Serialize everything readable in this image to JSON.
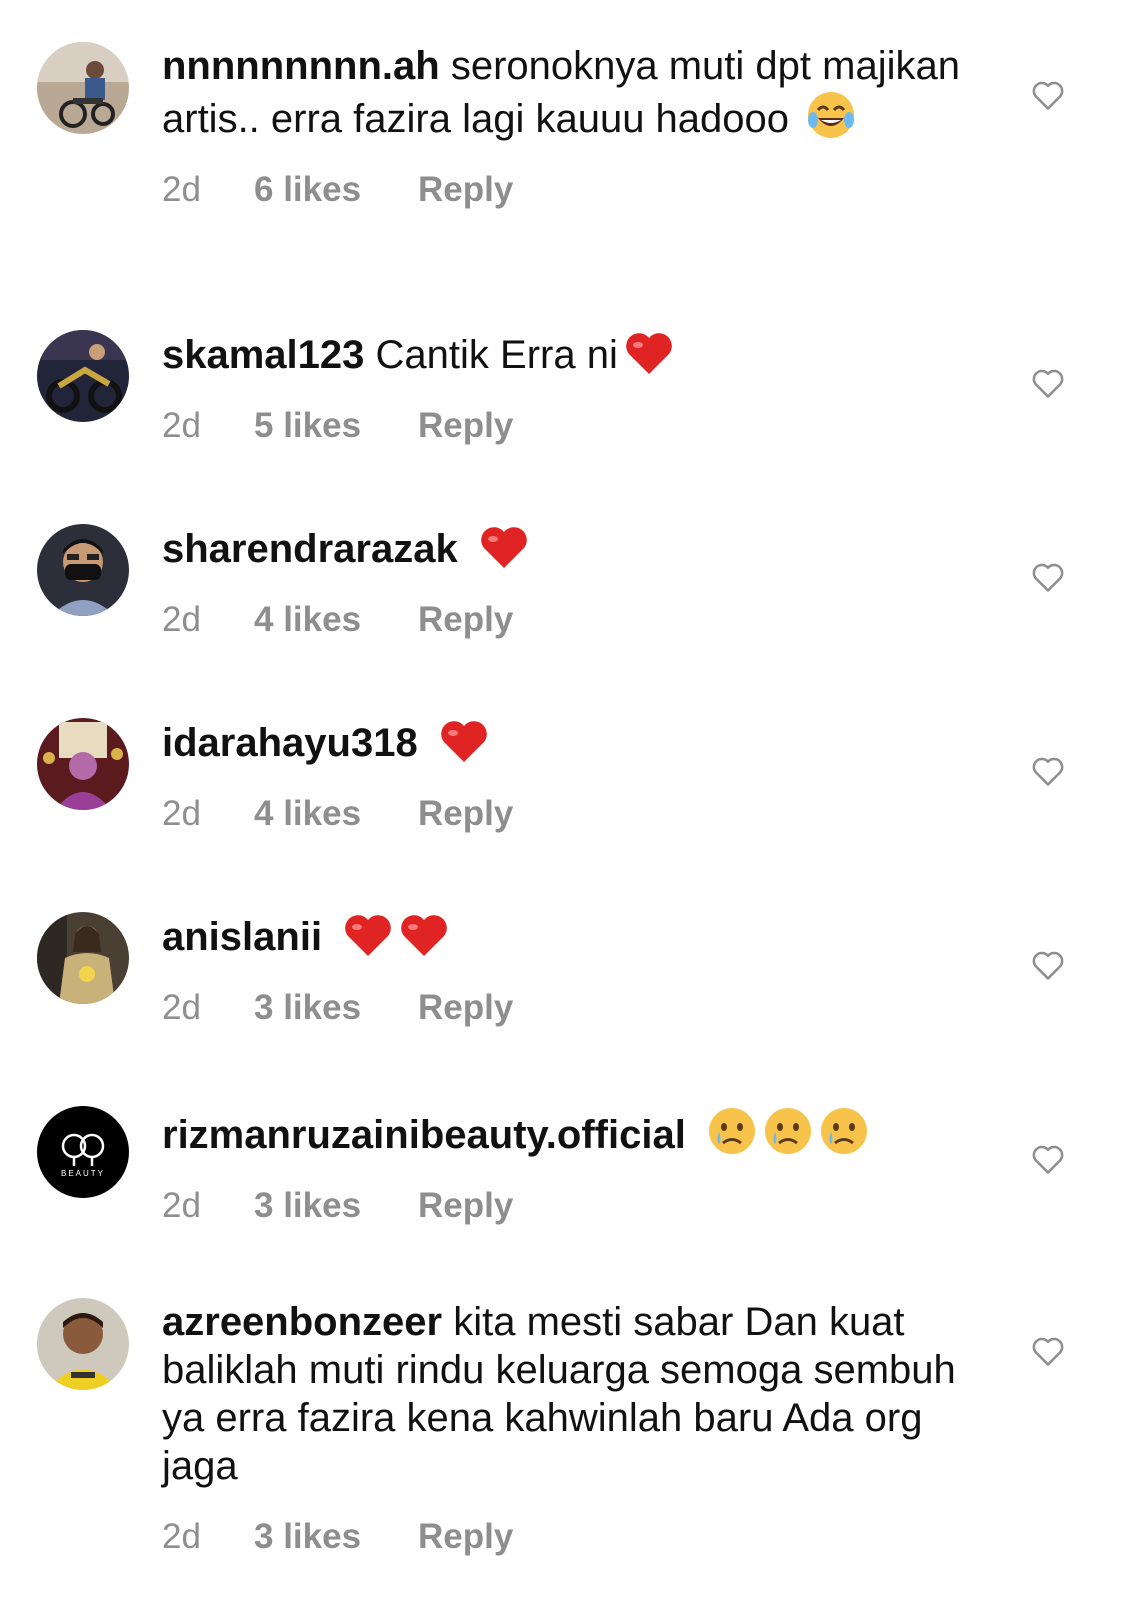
{
  "comments": [
    {
      "username": "nnnnnnnnn.ah",
      "text": "seronoknya muti dpt majikan artis.. erra fazira lagi kauuu hadooo",
      "emojis": [
        "face-with-tears-of-joy"
      ],
      "time": "2d",
      "likes": "6 likes",
      "reply": "Reply"
    },
    {
      "username": "skamal123",
      "text": "Cantik Erra ni",
      "emojis": [
        "red-heart"
      ],
      "time": "2d",
      "likes": "5 likes",
      "reply": "Reply"
    },
    {
      "username": "sharendrarazak",
      "text": "",
      "emojis": [
        "red-heart"
      ],
      "time": "2d",
      "likes": "4 likes",
      "reply": "Reply"
    },
    {
      "username": "idarahayu318",
      "text": "",
      "emojis": [
        "red-heart"
      ],
      "time": "2d",
      "likes": "4 likes",
      "reply": "Reply"
    },
    {
      "username": "anislanii",
      "text": "",
      "emojis": [
        "red-heart",
        "red-heart"
      ],
      "time": "2d",
      "likes": "3 likes",
      "reply": "Reply"
    },
    {
      "username": "rizmanruzainibeauty.official",
      "text": "",
      "emojis": [
        "crying-face",
        "crying-face",
        "crying-face"
      ],
      "time": "2d",
      "likes": "3 likes",
      "reply": "Reply",
      "avatar_logo_text": "BEAUTY"
    },
    {
      "username": "azreenbonzeer",
      "text": "kita mesti sabar Dan kuat baliklah muti rindu keluarga semoga sembuh ya erra fazira kena kahwinlah baru Ada org jaga",
      "emojis": [],
      "time": "2d",
      "likes": "3 likes",
      "reply": "Reply"
    }
  ],
  "colors": {
    "text": "#111111",
    "meta": "#8e8e8e",
    "heart_outline": "#8e8e8e",
    "emoji_heart": "#e02424"
  },
  "icons": {
    "like": "heart-outline-icon"
  }
}
